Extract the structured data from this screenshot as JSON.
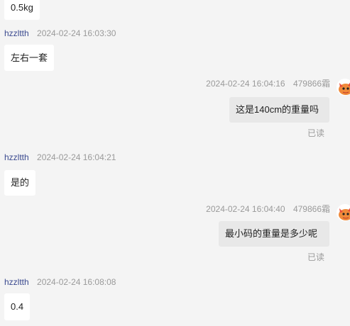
{
  "messages": [
    {
      "side": "left",
      "text": "0.5kg"
    },
    {
      "side": "left",
      "user": "hzzltth",
      "time": "2024-02-24 16:03:30",
      "text": "左右一套"
    },
    {
      "side": "right",
      "user": "479866霜",
      "time": "2024-02-24 16:04:16",
      "text": "这是140cm的重量吗",
      "read": "已读"
    },
    {
      "side": "left",
      "user": "hzzltth",
      "time": "2024-02-24 16:04:21",
      "text": "是的"
    },
    {
      "side": "right",
      "user": "479866霜",
      "time": "2024-02-24 16:04:40",
      "text": "最小码的重量是多少呢",
      "read": "已读"
    },
    {
      "side": "left",
      "user": "hzzltth",
      "time": "2024-02-24 16:08:08",
      "text": "0.4"
    }
  ],
  "colors": {
    "background": "#f4f4f4",
    "left_bubble": "#ffffff",
    "right_bubble": "#e8e8e8",
    "username": "#3b4a8f"
  }
}
